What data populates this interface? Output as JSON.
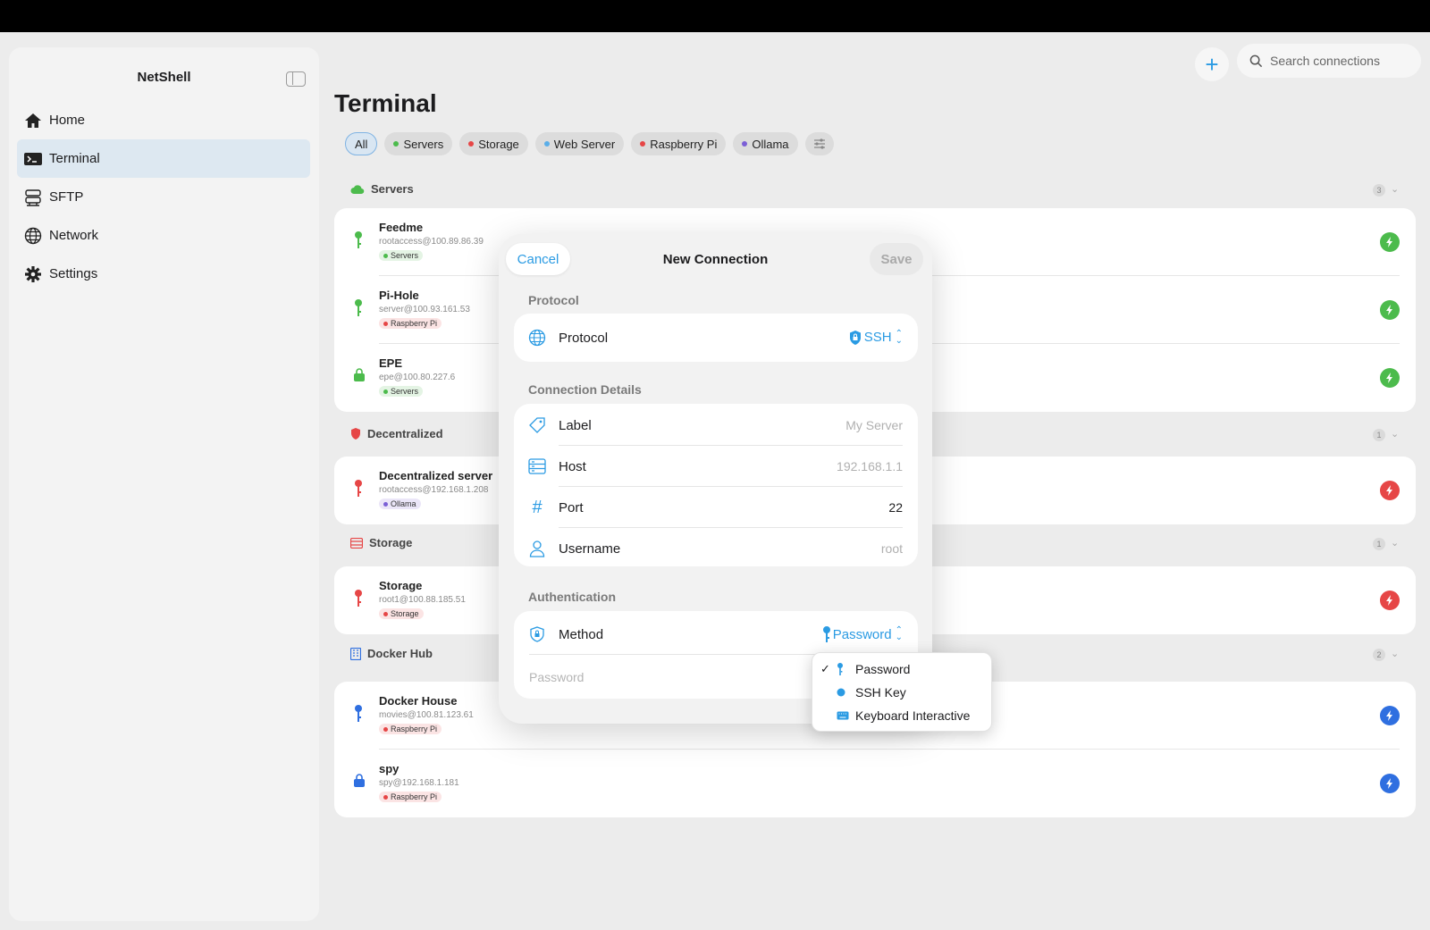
{
  "app": {
    "title": "NetShell"
  },
  "sidebar": {
    "items": [
      {
        "label": "Home",
        "icon": "house-icon"
      },
      {
        "label": "Terminal",
        "icon": "terminal-icon",
        "active": true
      },
      {
        "label": "SFTP",
        "icon": "server-stack-icon"
      },
      {
        "label": "Network",
        "icon": "globe-icon"
      },
      {
        "label": "Settings",
        "icon": "gear-icon"
      }
    ]
  },
  "search": {
    "placeholder": "Search connections"
  },
  "page": {
    "title": "Terminal"
  },
  "filters": [
    {
      "label": "All",
      "active": true
    },
    {
      "label": "Servers",
      "color": "#4cbb4c"
    },
    {
      "label": "Storage",
      "color": "#e64646"
    },
    {
      "label": "Web Server",
      "color": "#5aaee8"
    },
    {
      "label": "Raspberry Pi",
      "color": "#e64646"
    },
    {
      "label": "Ollama",
      "color": "#7b5fd6"
    }
  ],
  "sections": [
    {
      "title": "Servers",
      "count": "3",
      "color": "#4cbb4c",
      "rows": [
        {
          "name": "Feedme",
          "addr": "rootaccess@100.89.86.39",
          "tag": "Servers"
        },
        {
          "name": "Pi-Hole",
          "addr": "server@100.93.161.53",
          "tag": "Raspberry Pi"
        },
        {
          "name": "EPE",
          "addr": "epe@100.80.227.6",
          "tag": "Servers"
        }
      ]
    },
    {
      "title": "Decentralized",
      "count": "1",
      "color": "#e64646",
      "rows": [
        {
          "name": "Decentralized server",
          "addr": "rootaccess@192.168.1.208",
          "tag": "Ollama"
        }
      ]
    },
    {
      "title": "Storage",
      "count": "1",
      "color": "#e64646",
      "rows": [
        {
          "name": "Storage",
          "addr": "root1@100.88.185.51",
          "tag": "Storage"
        }
      ]
    },
    {
      "title": "Docker Hub",
      "count": "2",
      "color": "#2f6fe0",
      "rows": [
        {
          "name": "Docker House",
          "addr": "movies@100.81.123.61",
          "tag": "Raspberry Pi"
        },
        {
          "name": "spy",
          "addr": "spy@192.168.1.181",
          "tag": "Raspberry Pi"
        }
      ]
    }
  ],
  "modal": {
    "title": "New Connection",
    "cancel": "Cancel",
    "save": "Save",
    "protocol_group": "Protocol",
    "protocol_label": "Protocol",
    "protocol_value": "SSH",
    "details_group": "Connection Details",
    "label_label": "Label",
    "label_placeholder": "My Server",
    "host_label": "Host",
    "host_placeholder": "192.168.1.1",
    "port_label": "Port",
    "port_value": "22",
    "username_label": "Username",
    "username_placeholder": "root",
    "auth_group": "Authentication",
    "method_label": "Method",
    "method_value": "Password",
    "password_placeholder": "Password"
  },
  "dropdown": {
    "options": [
      {
        "label": "Password",
        "selected": true
      },
      {
        "label": "SSH Key"
      },
      {
        "label": "Keyboard Interactive"
      }
    ]
  },
  "colors": {
    "accent": "#2b9be3",
    "green": "#4cbb4c",
    "red": "#e64646",
    "blue": "#2f6fe0"
  }
}
